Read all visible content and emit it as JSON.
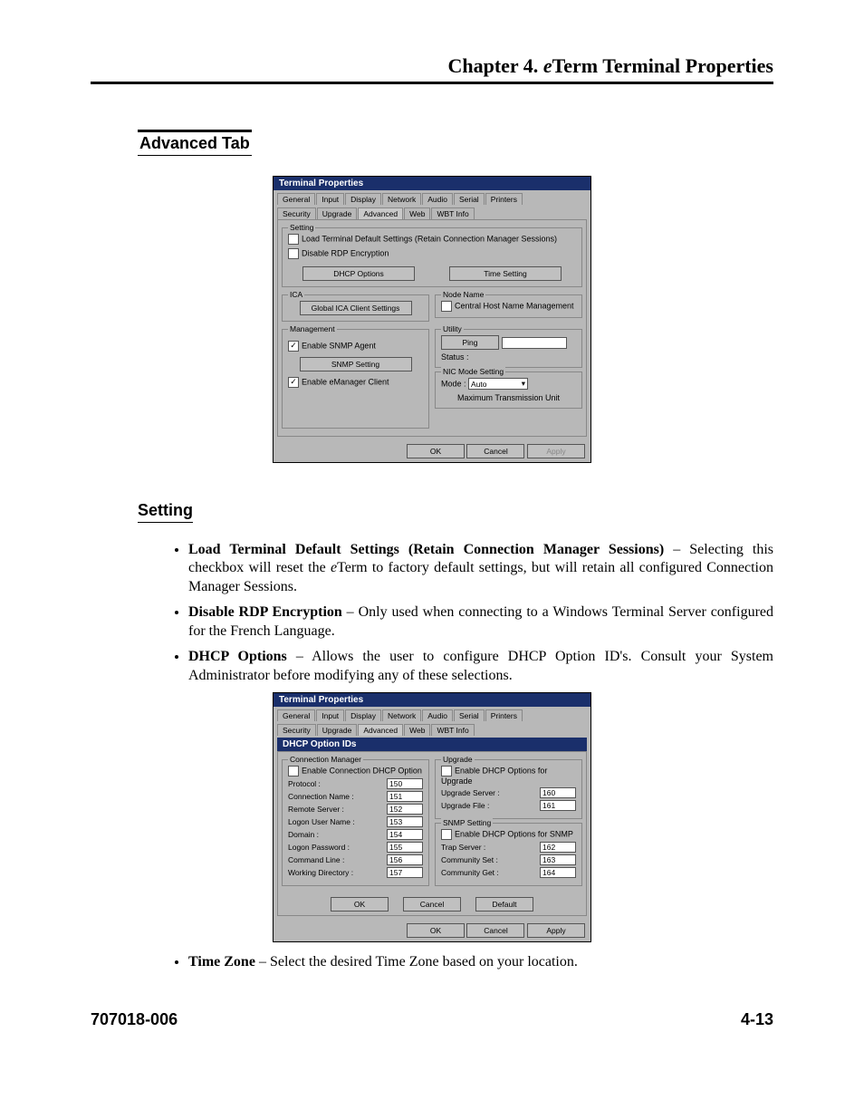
{
  "header": {
    "chapter": "Chapter 4.  ",
    "italic": "e",
    "rest": "Term Terminal Properties"
  },
  "section": {
    "advanced_tab": "Advanced Tab",
    "setting": "Setting"
  },
  "dialog1": {
    "title": "Terminal Properties",
    "tabs_row1": [
      "General",
      "Input",
      "Display",
      "Network",
      "Audio",
      "Serial",
      "Printers"
    ],
    "tabs_row2": [
      "Security",
      "Upgrade",
      "Advanced",
      "Web",
      "WBT Info"
    ],
    "setting_legend": "Setting",
    "cb_load": "Load Terminal Default Settings (Retain Connection Manager Sessions)",
    "cb_rdp": "Disable RDP Encryption",
    "btn_dhcp": "DHCP Options",
    "btn_time": "Time Setting",
    "ica_legend": "ICA",
    "btn_ica": "Global ICA Client Settings",
    "node_legend": "Node Name",
    "cb_node": "Central Host Name Management",
    "mgmt_legend": "Management",
    "cb_snmp": "Enable SNMP Agent",
    "btn_snmp": "SNMP Setting",
    "cb_emgr": "Enable eManager Client",
    "util_legend": "Utility",
    "btn_ping": "Ping",
    "status_label": "Status :",
    "nic_legend": "NIC Mode Setting",
    "mode_label": "Mode :",
    "mode_value": "Auto",
    "mtu": "Maximum Transmission Unit",
    "ok": "OK",
    "cancel": "Cancel",
    "apply": "Apply"
  },
  "bullets1": [
    {
      "bold": "Load Terminal Default Settings (Retain Connection Manager Sessions)",
      "rest1": " – Selecting this checkbox will reset the ",
      "italic": "e",
      "rest2": "Term to factory default settings, but will retain all configured Connection Manager Sessions."
    },
    {
      "bold": "Disable RDP Encryption",
      "rest1": " – Only used when connecting to a Windows Terminal Server configured for the French Language.",
      "italic": "",
      "rest2": ""
    },
    {
      "bold": "DHCP Options",
      "rest1": " – Allows the user to configure DHCP Option ID's. Consult your System Administrator before modifying any of these selections.",
      "italic": "",
      "rest2": ""
    }
  ],
  "dialog2": {
    "title": "Terminal Properties",
    "strip": "DHCP Option IDs",
    "tabs_row1": [
      "General",
      "Input",
      "Display",
      "Network",
      "Audio",
      "Serial",
      "Printers"
    ],
    "tabs_row2": [
      "Security",
      "Upgrade",
      "Advanced",
      "Web",
      "WBT Info"
    ],
    "cm_legend": "Connection Manager",
    "cb_cm": "Enable Connection DHCP Option",
    "cm_fields": [
      {
        "label": "Protocol :",
        "val": "150"
      },
      {
        "label": "Connection Name :",
        "val": "151"
      },
      {
        "label": "Remote Server :",
        "val": "152"
      },
      {
        "label": "Logon User Name :",
        "val": "153"
      },
      {
        "label": "Domain :",
        "val": "154"
      },
      {
        "label": "Logon Password :",
        "val": "155"
      },
      {
        "label": "Command Line :",
        "val": "156"
      },
      {
        "label": "Working Directory :",
        "val": "157"
      }
    ],
    "upg_legend": "Upgrade",
    "cb_upg": "Enable DHCP Options for Upgrade",
    "upg_fields": [
      {
        "label": "Upgrade Server :",
        "val": "160"
      },
      {
        "label": "Upgrade File :",
        "val": "161"
      }
    ],
    "snmp_legend": "SNMP Setting",
    "cb_snmp": "Enable DHCP Options for SNMP",
    "snmp_fields": [
      {
        "label": "Trap Server :",
        "val": "162"
      },
      {
        "label": "Community Set :",
        "val": "163"
      },
      {
        "label": "Community Get :",
        "val": "164"
      }
    ],
    "ok": "OK",
    "cancel": "Cancel",
    "default": "Default",
    "apply": "Apply"
  },
  "bullets2": [
    {
      "bold": "Time Zone",
      "rest1": " – Select the desired Time Zone based on your location.",
      "italic": "",
      "rest2": ""
    }
  ],
  "footer": {
    "doc": "707018-006",
    "page": "4-13"
  }
}
